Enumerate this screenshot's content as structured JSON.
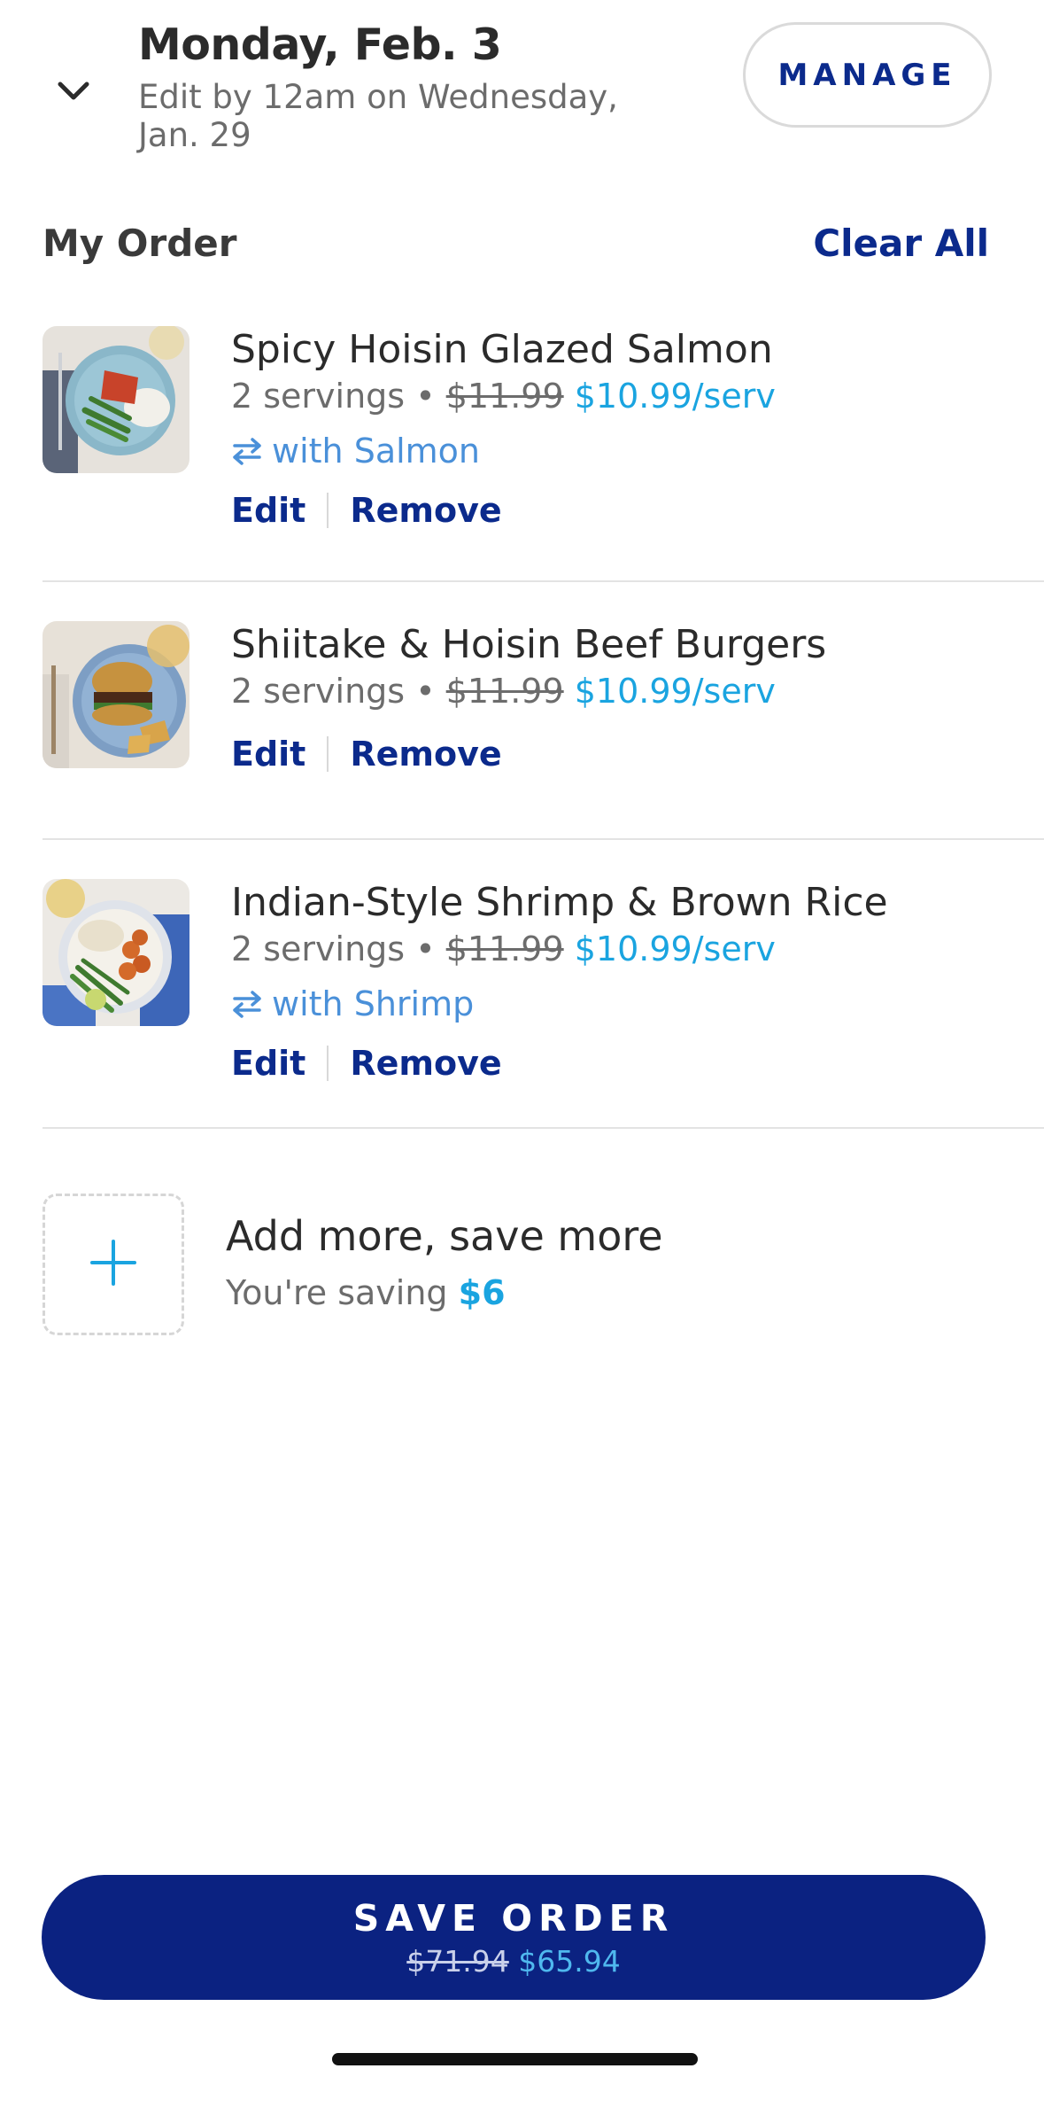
{
  "header": {
    "date": "Monday, Feb. 3",
    "deadline": "Edit by 12am on Wednesday, Jan. 29",
    "manage_label": "MANAGE"
  },
  "order": {
    "title": "My Order",
    "clear_all_label": "Clear All",
    "items": [
      {
        "name": "Spicy Hoisin Glazed Salmon",
        "servings": "2 servings",
        "old_price": "$11.99",
        "new_price": "$10.99/serv",
        "swap": "with Salmon",
        "edit_label": "Edit",
        "remove_label": "Remove"
      },
      {
        "name": "Shiitake & Hoisin Beef Burgers",
        "servings": "2 servings",
        "old_price": "$11.99",
        "new_price": "$10.99/serv",
        "edit_label": "Edit",
        "remove_label": "Remove"
      },
      {
        "name": "Indian-Style Shrimp & Brown Rice",
        "servings": "2 servings",
        "old_price": "$11.99",
        "new_price": "$10.99/serv",
        "swap": "with Shrimp",
        "edit_label": "Edit",
        "remove_label": "Remove"
      }
    ]
  },
  "add_more": {
    "title": "Add more, save more",
    "saving_prefix": "You're saving",
    "saving_amount": "$6"
  },
  "save": {
    "label": "SAVE ORDER",
    "old_total": "$71.94",
    "new_total": "$65.94"
  },
  "colors": {
    "brand_navy": "#0b2a8c",
    "price_blue": "#1aa4e0",
    "swap_blue": "#4a90d9"
  }
}
